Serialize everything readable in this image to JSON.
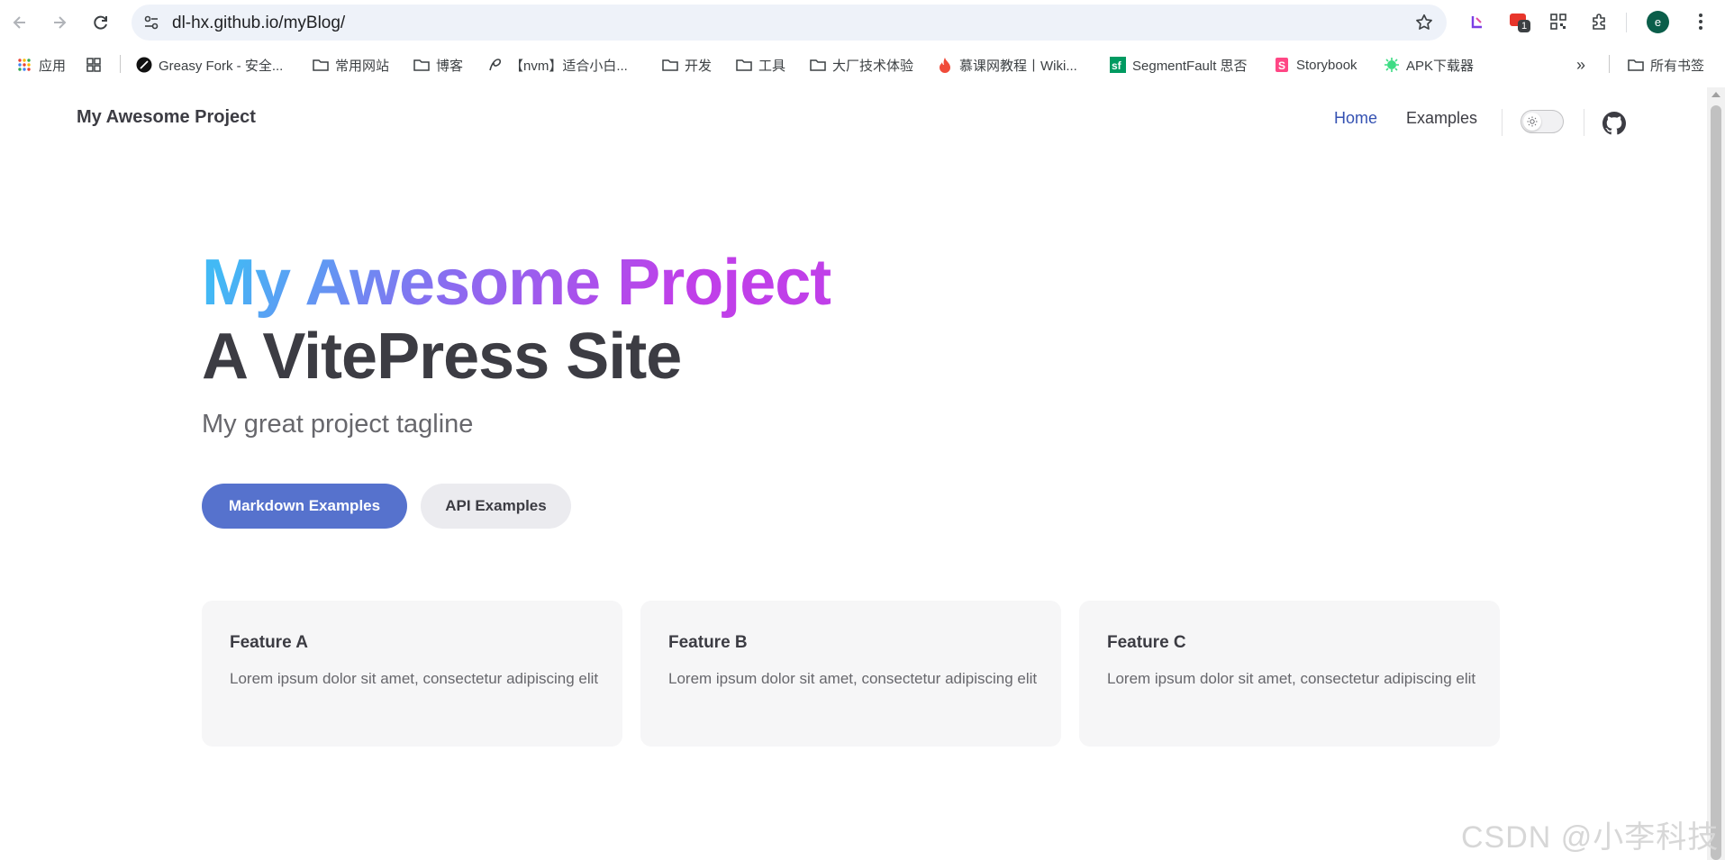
{
  "browser": {
    "url": "dl-hx.github.io/myBlog/",
    "extension_badge": "1",
    "profile_initial": "e",
    "bookmarks": [
      {
        "label": "应用",
        "icon": "apps-grid-icon"
      },
      {
        "label": "Greasy Fork - 安全...",
        "icon": "greasyfork-icon"
      },
      {
        "label": "常用网站",
        "icon": "folder-icon"
      },
      {
        "label": "博客",
        "icon": "folder-icon"
      },
      {
        "label": "【nvm】适合小白...",
        "icon": "nvm-icon"
      },
      {
        "label": "开发",
        "icon": "folder-icon"
      },
      {
        "label": "工具",
        "icon": "folder-icon"
      },
      {
        "label": "大厂技术体验",
        "icon": "folder-icon"
      },
      {
        "label": "慕课网教程丨Wiki...",
        "icon": "flame-icon"
      },
      {
        "label": "SegmentFault 思否",
        "icon": "segmentfault-icon"
      },
      {
        "label": "Storybook",
        "icon": "storybook-icon"
      },
      {
        "label": "APK下载器",
        "icon": "android-icon"
      }
    ],
    "all_bookmarks_label": "所有书签",
    "overflow_label": "»"
  },
  "nav": {
    "site_title": "My Awesome Project",
    "links": [
      {
        "label": "Home",
        "active": true
      },
      {
        "label": "Examples",
        "active": false
      }
    ]
  },
  "hero": {
    "name": "My Awesome Project",
    "text": "A VitePress Site",
    "tagline": "My great project tagline",
    "actions": [
      {
        "label": "Markdown Examples",
        "theme": "brand"
      },
      {
        "label": "API Examples",
        "theme": "alt"
      }
    ]
  },
  "features": [
    {
      "title": "Feature A",
      "details": "Lorem ipsum dolor sit amet, consectetur adipiscing elit"
    },
    {
      "title": "Feature B",
      "details": "Lorem ipsum dolor sit amet, consectetur adipiscing elit"
    },
    {
      "title": "Feature C",
      "details": "Lorem ipsum dolor sit amet, consectetur adipiscing elit"
    }
  ],
  "watermark": "CSDN @小李科技",
  "colors": {
    "brand": "#5672cd",
    "link_active": "#3451b2",
    "gradient_start": "#42b9f5",
    "gradient_end": "#c03fe9"
  }
}
